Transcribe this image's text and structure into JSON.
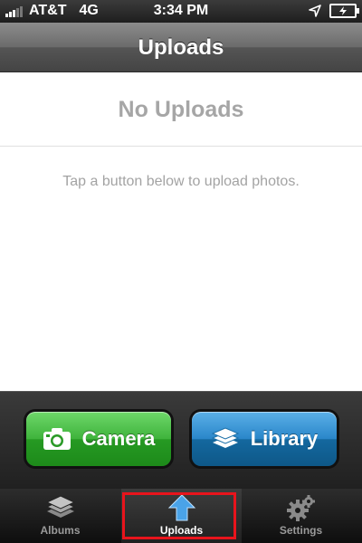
{
  "status_bar": {
    "carrier": "AT&T",
    "network": "4G",
    "time": "3:34 PM",
    "icons": [
      "signal-icon",
      "location-icon",
      "battery-charging-icon"
    ]
  },
  "nav": {
    "title": "Uploads"
  },
  "empty_state": {
    "title": "No Uploads",
    "hint": "Tap a button below to upload photos."
  },
  "actions": {
    "camera_label": "Camera",
    "library_label": "Library",
    "camera_color": "#3fb33c",
    "library_color": "#1a73b5"
  },
  "tabs": [
    {
      "label": "Albums",
      "icon": "albums-icon",
      "selected": false
    },
    {
      "label": "Uploads",
      "icon": "upload-arrow-icon",
      "selected": true
    },
    {
      "label": "Settings",
      "icon": "gear-icon",
      "selected": false
    }
  ],
  "colors": {
    "highlight": "#e8141c",
    "upload_icon": "#4aa3e8"
  }
}
